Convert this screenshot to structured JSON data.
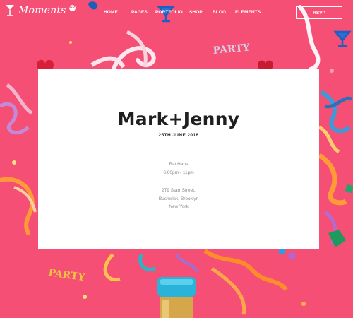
{
  "header": {
    "logo_text": "Moments",
    "logo_badge": "WP",
    "nav": [
      "HOME",
      "PAGES",
      "PORTFOLIO",
      "SHOP",
      "BLOG",
      "ELEMENTS"
    ],
    "rsvp_label": "RSVP"
  },
  "card": {
    "names": "Mark+Jenny",
    "date": "25TH JUNE 2016",
    "venue": "Bat Haus",
    "time": "6:00pm - 11pm",
    "address_line1": "279 Starr Street,",
    "address_line2": "Bushwick, Brooklyn",
    "address_line3": "New York"
  },
  "background": {
    "color": "#f2466c",
    "decorations": [
      "PARTY",
      "PARTY"
    ]
  }
}
